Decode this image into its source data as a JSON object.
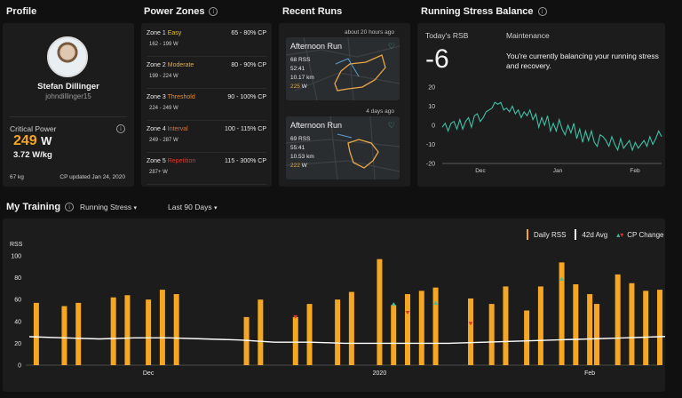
{
  "profile": {
    "title": "Profile",
    "name": "Stefan Dillinger",
    "username": "johndillinger15",
    "cp_label": "Critical Power",
    "cp_value": "249",
    "cp_unit": "W",
    "wkg_value": "3.72",
    "wkg_unit": "W/kg",
    "weight": "67 kg",
    "updated": "CP updated Jan 24, 2020"
  },
  "zones": {
    "title": "Power Zones",
    "items": [
      {
        "label": "Zone 1",
        "name": "Easy",
        "color": "#e6c229",
        "watts": "162 - 199 W",
        "pct": "65 - 80% CP"
      },
      {
        "label": "Zone 2",
        "name": "Moderate",
        "color": "#f5a623",
        "watts": "199 - 224 W",
        "pct": "80 - 90% CP"
      },
      {
        "label": "Zone 3",
        "name": "Threshold",
        "color": "#f08a24",
        "watts": "224 - 249 W",
        "pct": "90 - 100% CP"
      },
      {
        "label": "Zone 4",
        "name": "Interval",
        "color": "#ef6a2b",
        "watts": "249 - 287 W",
        "pct": "100 - 115% CP"
      },
      {
        "label": "Zone 5",
        "name": "Repetition",
        "color": "#d83a2a",
        "watts": "287+ W",
        "pct": "115 - 300% CP"
      }
    ]
  },
  "runs": {
    "title": "Recent Runs",
    "items": [
      {
        "ago": "about 20 hours ago",
        "name": "Afternoon Run",
        "rss": "68",
        "rss_unit": "RSS",
        "time": "52:41",
        "dist": "10.17",
        "dist_unit": "km",
        "power": "225",
        "power_unit": "W"
      },
      {
        "ago": "4 days ago",
        "name": "Afternoon Run",
        "rss": "69",
        "rss_unit": "RSS",
        "time": "55:41",
        "dist": "10.53",
        "dist_unit": "km",
        "power": "222",
        "power_unit": "W"
      }
    ]
  },
  "rsb": {
    "title": "Running Stress Balance",
    "today_label": "Today's RSB",
    "today_value": "-6",
    "status": "Maintenance",
    "message": "You're currently balancing your running stress and recovery.",
    "yticks": [
      "20",
      "10",
      "0",
      "-10",
      "-20"
    ],
    "xticks": [
      "Dec",
      "Jan",
      "Feb"
    ],
    "line_color": "#3fc1a5"
  },
  "training": {
    "title": "My Training",
    "metric_select": "Running Stress",
    "range_select": "Last 90 Days",
    "legend_daily": "Daily RSS",
    "legend_avg": "42d Avg",
    "legend_cp": "CP Change",
    "bar_color": "#f5a623"
  },
  "chart_data": [
    {
      "type": "line",
      "title": "Running Stress Balance",
      "ylim": [
        -20,
        20
      ],
      "x_tick_labels": [
        "Dec",
        "Jan",
        "Feb"
      ],
      "series": [
        {
          "values": [
            -1,
            1,
            -3,
            1,
            2,
            -2,
            3,
            -2,
            2,
            4,
            -1,
            5,
            6,
            2,
            4,
            7,
            8,
            9,
            12,
            11,
            12,
            8,
            9,
            7,
            10,
            6,
            8,
            4,
            7,
            5,
            8,
            3,
            6,
            -1,
            4,
            0,
            5,
            -3,
            1,
            -3,
            3,
            -2,
            -5,
            0,
            -4,
            1,
            -7,
            -2,
            -9,
            -3,
            -8,
            -3,
            -9,
            -11,
            -5,
            -6,
            -8,
            -11,
            -6,
            -10,
            -13,
            -7,
            -12,
            -10,
            -8,
            -13,
            -9,
            -12,
            -10,
            -8,
            -11,
            -6,
            -10,
            -7,
            -3,
            -6
          ]
        }
      ]
    },
    {
      "type": "bar",
      "title": "",
      "ylabel": "RSS",
      "ylim": [
        0,
        100
      ],
      "y_tick_labels": [
        "0",
        "20",
        "40",
        "60",
        "80",
        "100"
      ],
      "x_tick_labels": [
        "Dec",
        "2020",
        "Feb"
      ],
      "days": 90,
      "series": [
        {
          "name": "Daily RSS",
          "points": [
            [
              1,
              57
            ],
            [
              5,
              54
            ],
            [
              7,
              57
            ],
            [
              12,
              62
            ],
            [
              14,
              64
            ],
            [
              17,
              60
            ],
            [
              19,
              69
            ],
            [
              21,
              65
            ],
            [
              31,
              44
            ],
            [
              33,
              60
            ],
            [
              38,
              44
            ],
            [
              40,
              56
            ],
            [
              44,
              60
            ],
            [
              46,
              67
            ],
            [
              50,
              97
            ],
            [
              52,
              55
            ],
            [
              54,
              65
            ],
            [
              56,
              68
            ],
            [
              58,
              71
            ],
            [
              63,
              61
            ],
            [
              66,
              56
            ],
            [
              68,
              72
            ],
            [
              71,
              50
            ],
            [
              73,
              72
            ],
            [
              76,
              94
            ],
            [
              78,
              74
            ],
            [
              80,
              65
            ],
            [
              81,
              56
            ],
            [
              84,
              83
            ],
            [
              86,
              75
            ],
            [
              88,
              68
            ],
            [
              90,
              69
            ],
            [
              92,
              69
            ],
            [
              95,
              69
            ]
          ]
        },
        {
          "name": "42d Avg",
          "points": [
            [
              0,
              26
            ],
            [
              5,
              25
            ],
            [
              10,
              24
            ],
            [
              15,
              25
            ],
            [
              20,
              25
            ],
            [
              25,
              24
            ],
            [
              30,
              23
            ],
            [
              35,
              21
            ],
            [
              40,
              21
            ],
            [
              45,
              20
            ],
            [
              50,
              20
            ],
            [
              55,
              20
            ],
            [
              60,
              20
            ],
            [
              65,
              21
            ],
            [
              70,
              22
            ],
            [
              75,
              23
            ],
            [
              80,
              24
            ],
            [
              85,
              25
            ],
            [
              90,
              26
            ],
            [
              96,
              27
            ]
          ]
        },
        {
          "name": "CP Change",
          "points": [
            [
              38,
              44
            ],
            [
              52,
              56
            ],
            [
              54,
              48
            ],
            [
              58,
              57
            ],
            [
              63,
              38
            ],
            [
              76,
              79
            ]
          ]
        }
      ]
    }
  ]
}
